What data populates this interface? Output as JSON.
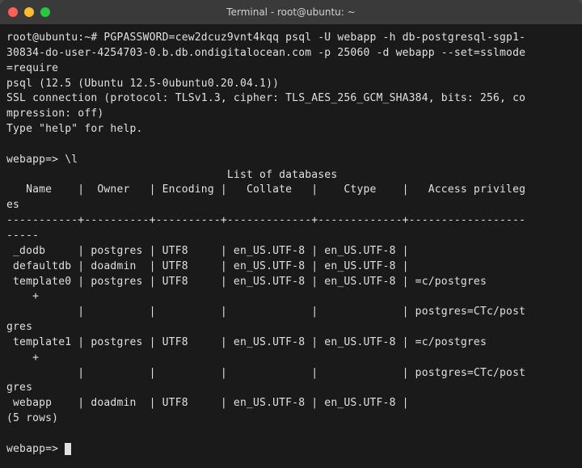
{
  "titlebar": {
    "title": "Terminal - root@ubuntu: ~"
  },
  "term": {
    "line_cmd1": "root@ubuntu:~# PGPASSWORD=cew2dcuz9vnt4kqq psql -U webapp -h db-postgresql-sgp1-",
    "line_cmd2": "30834-do-user-4254703-0.b.db.ondigitalocean.com -p 25060 -d webapp --set=sslmode",
    "line_cmd3": "=require",
    "line_psql_ver": "psql (12.5 (Ubuntu 12.5-0ubuntu0.20.04.1))",
    "line_ssl1": "SSL connection (protocol: TLSv1.3, cipher: TLS_AES_256_GCM_SHA384, bits: 256, co",
    "line_ssl2": "mpression: off)",
    "line_help": "Type \"help\" for help.",
    "blank": "",
    "line_l": "webapp=> \\l",
    "line_title": "                                  List of databases",
    "line_hdr1": "   Name    |  Owner   | Encoding |   Collate   |    Ctype    |   Access privileg",
    "line_hdr2": "es   ",
    "line_sep1": "-----------+----------+----------+-------------+-------------+------------------",
    "line_sep2": "-----",
    "row1": " _dodb     | postgres | UTF8     | en_US.UTF-8 | en_US.UTF-8 | ",
    "row2": " defaultdb | doadmin  | UTF8     | en_US.UTF-8 | en_US.UTF-8 | ",
    "row3a": " template0 | postgres | UTF8     | en_US.UTF-8 | en_US.UTF-8 | =c/postgres       ",
    "row3b": "    +",
    "row3c": "           |          |          |             |             | postgres=CTc/post",
    "row3d": "gres",
    "row4a": " template1 | postgres | UTF8     | en_US.UTF-8 | en_US.UTF-8 | =c/postgres       ",
    "row4b": "    +",
    "row4c": "           |          |          |             |             | postgres=CTc/post",
    "row4d": "gres",
    "row5": " webapp    | doadmin  | UTF8     | en_US.UTF-8 | en_US.UTF-8 | ",
    "rows_count": "(5 rows)",
    "prompt_final": "webapp=> "
  }
}
